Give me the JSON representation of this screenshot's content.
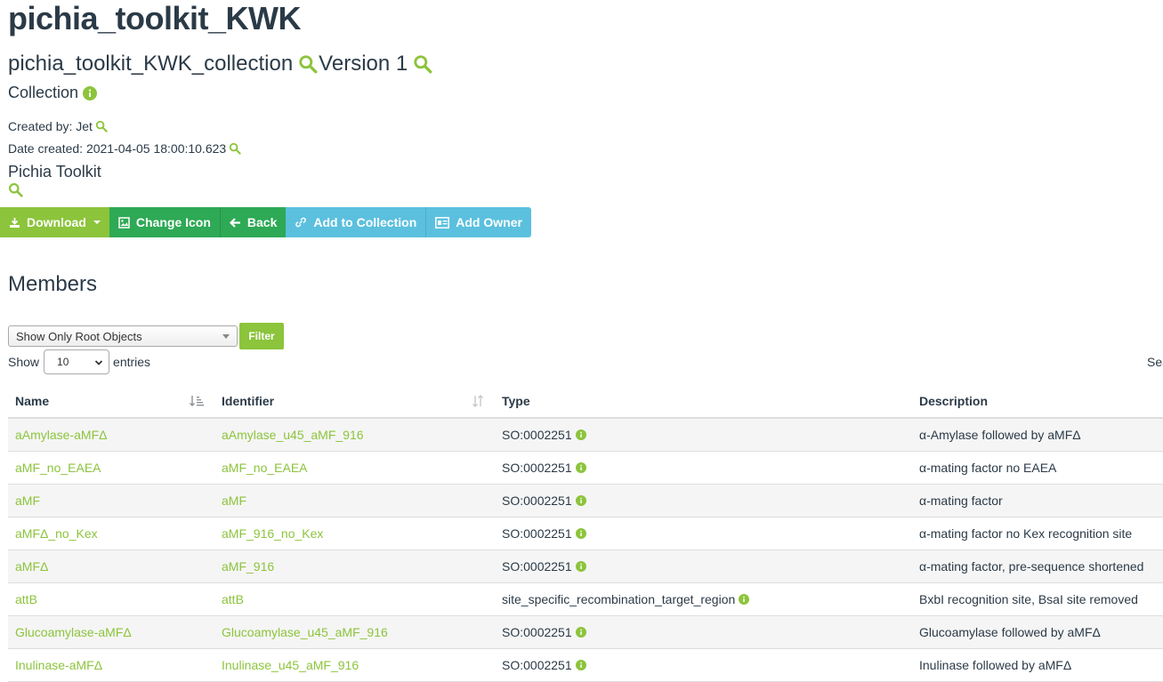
{
  "page": {
    "title": "pichia_toolkit_KWK",
    "collection_name": "pichia_toolkit_KWK_collection",
    "version": "Version 1",
    "kind": "Collection",
    "created_by_label": "Created by: Jet",
    "date_created_label": "Date created: 2021-04-05 18:00:10.623",
    "project": "Pichia Toolkit"
  },
  "toolbar": {
    "download": "Download",
    "change_icon": "Change Icon",
    "back": "Back",
    "add_to_collection": "Add to Collection",
    "add_owner": "Add Owner"
  },
  "members": {
    "heading": "Members",
    "filter_select": "Show Only Root Objects",
    "filter_button": "Filter",
    "show_label": "Show",
    "entries_value": "10",
    "entries_label": "entries",
    "search_label": "Sea",
    "columns": [
      "Name",
      "Identifier",
      "Type",
      "Description"
    ],
    "rows": [
      {
        "name": "aAmylase-aMFΔ",
        "identifier": "aAmylase_u45_aMF_916",
        "type": "SO:0002251",
        "description": "α-Amylase followed by aMFΔ"
      },
      {
        "name": "aMF_no_EAEA",
        "identifier": "aMF_no_EAEA",
        "type": "SO:0002251",
        "description": "α-mating factor no EAEA"
      },
      {
        "name": "aMF",
        "identifier": "aMF",
        "type": "SO:0002251",
        "description": "α-mating factor"
      },
      {
        "name": "aMFΔ_no_Kex",
        "identifier": "aMF_916_no_Kex",
        "type": "SO:0002251",
        "description": "α-mating factor no Kex recognition site"
      },
      {
        "name": "aMFΔ",
        "identifier": "aMF_916",
        "type": "SO:0002251",
        "description": "α-mating factor, pre-sequence shortened"
      },
      {
        "name": "attB",
        "identifier": "attB",
        "type": "site_specific_recombination_target_region",
        "description": "BxbI recognition site, BsaI site removed"
      },
      {
        "name": "Glucoamylase-aMFΔ",
        "identifier": "Glucoamylase_u45_aMF_916",
        "type": "SO:0002251",
        "description": "Glucoamylase followed by aMFΔ"
      },
      {
        "name": "Inulinase-aMFΔ",
        "identifier": "Inulinase_u45_aMF_916",
        "type": "SO:0002251",
        "description": "Inulinase followed by aMFΔ"
      }
    ]
  },
  "colors": {
    "accent_green": "#8cc43c",
    "button_green": "#2ea955",
    "button_blue": "#5bc0de",
    "text": "#2b3a47"
  },
  "icons": [
    "search-icon",
    "info-icon",
    "download-icon",
    "caret-down-icon",
    "image-icon",
    "arrow-left-icon",
    "link-icon",
    "id-card-icon",
    "sort-icon"
  ]
}
